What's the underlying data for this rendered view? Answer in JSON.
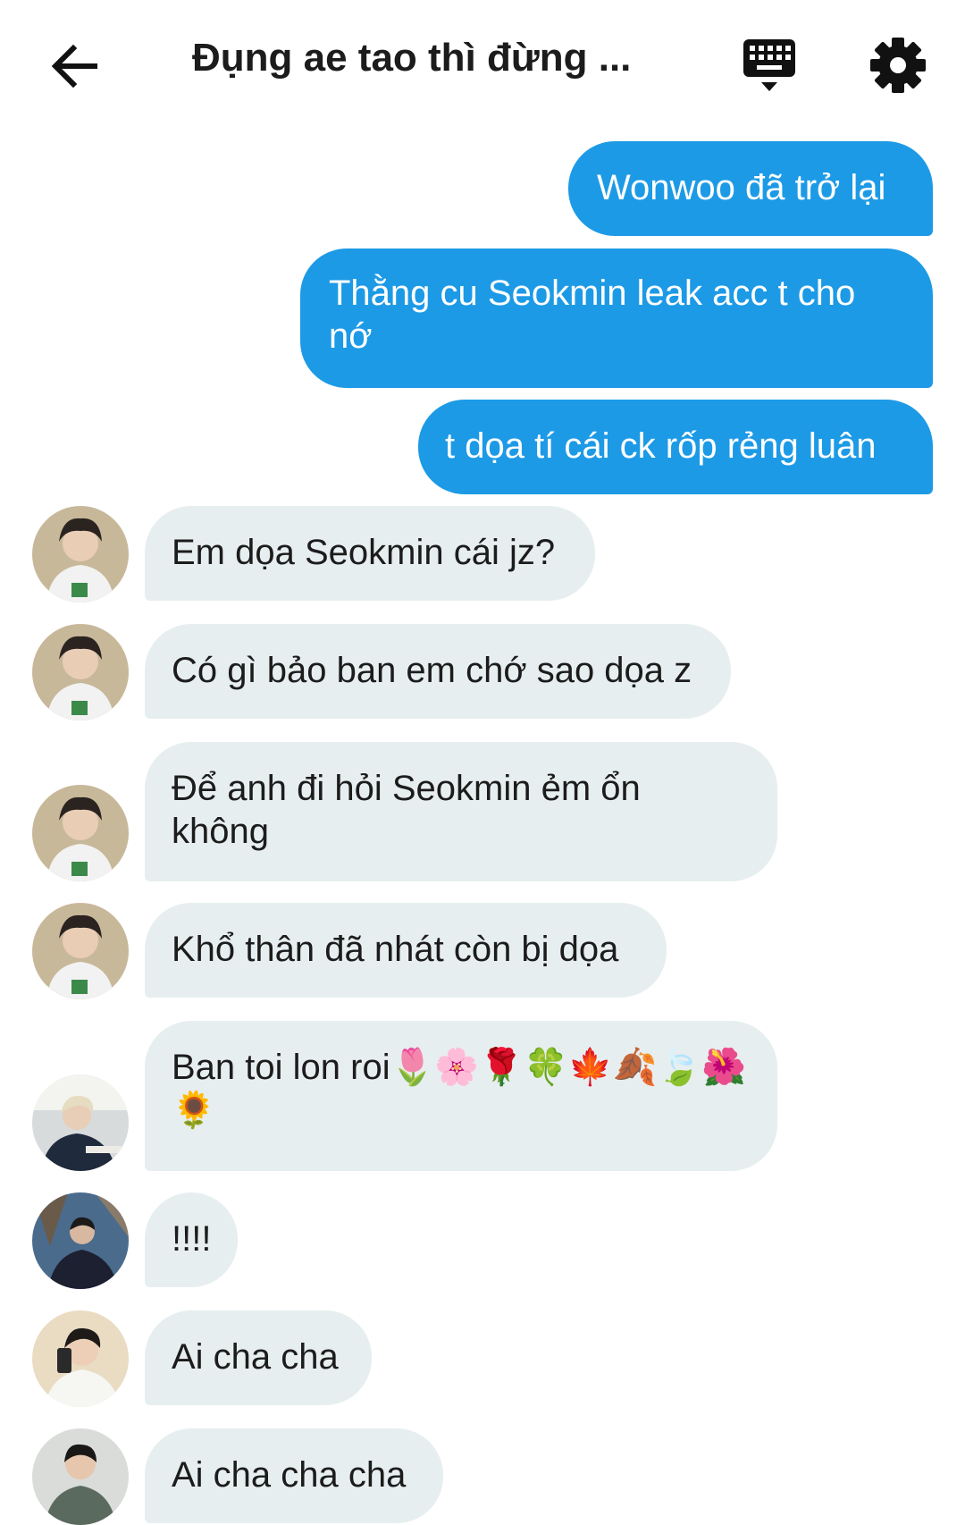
{
  "header": {
    "title": "Đụng ae tao thì đừng ...",
    "back_icon": "arrow-left-icon",
    "keyboard_icon": "keyboard-icon",
    "settings_icon": "gear-icon"
  },
  "colors": {
    "outgoing_bubble": "#1d9ae6",
    "incoming_bubble": "#e7eeef"
  },
  "messages": [
    {
      "direction": "outgoing",
      "text": "Wonwoo đã trở lại"
    },
    {
      "direction": "outgoing",
      "text": "Thằng cu Seokmin leak acc t cho nớ"
    },
    {
      "direction": "outgoing",
      "text": "t dọa tí cái ck rốp rẻng luân"
    },
    {
      "direction": "incoming",
      "text": "Em dọa Seokmin cái jz?"
    },
    {
      "direction": "incoming",
      "text": "Có gì bảo ban em chớ sao dọa z"
    },
    {
      "direction": "incoming",
      "text": "Để anh đi hỏi Seokmin ẻm ổn không"
    },
    {
      "direction": "incoming",
      "text": "Khổ thân đã nhát còn bị dọa"
    },
    {
      "direction": "incoming",
      "text": "Ban toi lon roi",
      "emoji": "🌷🌸🌹🍀🍁🍂🍃🌺🌻"
    },
    {
      "direction": "incoming",
      "text": "!!!!"
    },
    {
      "direction": "incoming",
      "text": "Ai cha cha"
    },
    {
      "direction": "incoming",
      "text": "Ai cha cha cha"
    }
  ]
}
